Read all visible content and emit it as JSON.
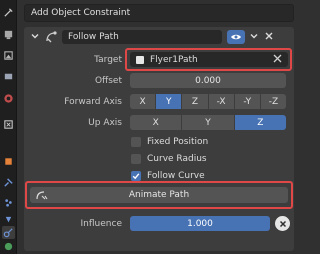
{
  "add_constraint": {
    "label": "Add Object Constraint"
  },
  "constraint": {
    "name": "Follow Path",
    "target": {
      "label": "Target",
      "value": "Flyer1Path"
    },
    "offset": {
      "label": "Offset",
      "value": "0.000"
    },
    "forward_axis": {
      "label": "Forward Axis",
      "options": [
        "X",
        "Y",
        "Z",
        "-X",
        "-Y",
        "-Z"
      ],
      "selected": "Y"
    },
    "up_axis": {
      "label": "Up Axis",
      "options": [
        "X",
        "Y",
        "Z"
      ],
      "selected": "Z"
    },
    "fixed_position": {
      "label": "Fixed Position",
      "checked": false
    },
    "curve_radius": {
      "label": "Curve Radius",
      "checked": false
    },
    "follow_curve": {
      "label": "Follow Curve",
      "checked": true
    },
    "animate_path": {
      "label": "Animate Path"
    },
    "influence": {
      "label": "Influence",
      "value": "1.000"
    }
  },
  "icons": {
    "header": [
      "chevron-down-icon",
      "constraint-icon",
      "eye-icon",
      "chevron-down-icon",
      "close-icon"
    ],
    "tabs": [
      "tool-icon",
      "render-icon",
      "output-icon",
      "view-layer-icon",
      "scene-icon",
      "world-icon",
      "object-icon",
      "modifier-icon",
      "particles-icon",
      "physics-icon",
      "constraint-icon",
      "data-icon"
    ]
  },
  "colors": {
    "accent": "#4772b3",
    "highlight": "#e04848",
    "panel_bg": "#3d3d3d"
  }
}
